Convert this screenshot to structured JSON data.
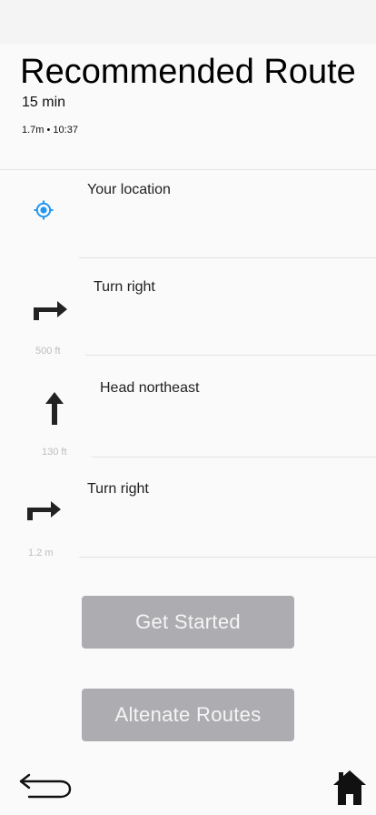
{
  "header": {
    "title": "Recommended Route",
    "duration": "15 min",
    "meta": "1.7m • 10:37"
  },
  "steps": [
    {
      "label": "Your location",
      "icon": "my-location-icon",
      "distance": ""
    },
    {
      "label": "Turn right",
      "icon": "turn-right-icon",
      "distance": "500 ft"
    },
    {
      "label": "Head northeast",
      "icon": "arrow-up-icon",
      "distance": "130 ft"
    },
    {
      "label": "Turn right",
      "icon": "turn-right-icon",
      "distance": "1.2 m"
    }
  ],
  "actions": {
    "get_started": "Get Started",
    "alternate_routes": "Altenate Routes"
  },
  "bottom_nav": {
    "back_icon": "back-arrow-icon",
    "home_icon": "home-icon"
  },
  "colors": {
    "location_icon": "#2196f3",
    "button_bg": "#adadb1",
    "button_text": "#f5f5f5",
    "distance_text": "#bdbdbd"
  }
}
